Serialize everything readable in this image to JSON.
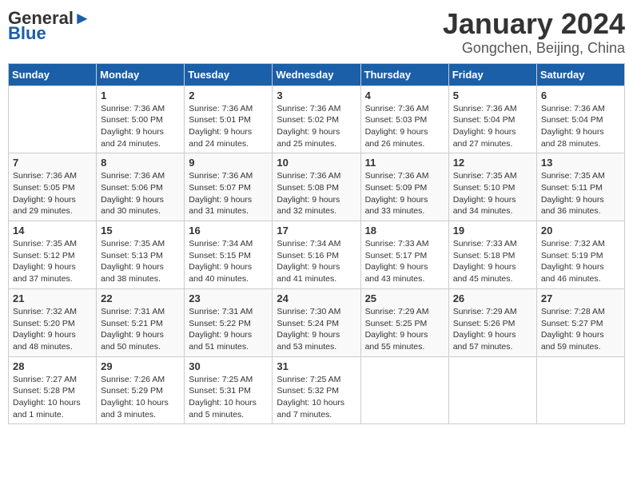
{
  "logo": {
    "name_part1": "General",
    "name_part2": "Blue"
  },
  "title": "January 2024",
  "subtitle": "Gongchen, Beijing, China",
  "weekdays": [
    "Sunday",
    "Monday",
    "Tuesday",
    "Wednesday",
    "Thursday",
    "Friday",
    "Saturday"
  ],
  "weeks": [
    [
      {
        "day": "",
        "sunrise": "",
        "sunset": "",
        "daylight": ""
      },
      {
        "day": "1",
        "sunrise": "Sunrise: 7:36 AM",
        "sunset": "Sunset: 5:00 PM",
        "daylight": "Daylight: 9 hours and 24 minutes."
      },
      {
        "day": "2",
        "sunrise": "Sunrise: 7:36 AM",
        "sunset": "Sunset: 5:01 PM",
        "daylight": "Daylight: 9 hours and 24 minutes."
      },
      {
        "day": "3",
        "sunrise": "Sunrise: 7:36 AM",
        "sunset": "Sunset: 5:02 PM",
        "daylight": "Daylight: 9 hours and 25 minutes."
      },
      {
        "day": "4",
        "sunrise": "Sunrise: 7:36 AM",
        "sunset": "Sunset: 5:03 PM",
        "daylight": "Daylight: 9 hours and 26 minutes."
      },
      {
        "day": "5",
        "sunrise": "Sunrise: 7:36 AM",
        "sunset": "Sunset: 5:04 PM",
        "daylight": "Daylight: 9 hours and 27 minutes."
      },
      {
        "day": "6",
        "sunrise": "Sunrise: 7:36 AM",
        "sunset": "Sunset: 5:04 PM",
        "daylight": "Daylight: 9 hours and 28 minutes."
      }
    ],
    [
      {
        "day": "7",
        "sunrise": "Sunrise: 7:36 AM",
        "sunset": "Sunset: 5:05 PM",
        "daylight": "Daylight: 9 hours and 29 minutes."
      },
      {
        "day": "8",
        "sunrise": "Sunrise: 7:36 AM",
        "sunset": "Sunset: 5:06 PM",
        "daylight": "Daylight: 9 hours and 30 minutes."
      },
      {
        "day": "9",
        "sunrise": "Sunrise: 7:36 AM",
        "sunset": "Sunset: 5:07 PM",
        "daylight": "Daylight: 9 hours and 31 minutes."
      },
      {
        "day": "10",
        "sunrise": "Sunrise: 7:36 AM",
        "sunset": "Sunset: 5:08 PM",
        "daylight": "Daylight: 9 hours and 32 minutes."
      },
      {
        "day": "11",
        "sunrise": "Sunrise: 7:36 AM",
        "sunset": "Sunset: 5:09 PM",
        "daylight": "Daylight: 9 hours and 33 minutes."
      },
      {
        "day": "12",
        "sunrise": "Sunrise: 7:35 AM",
        "sunset": "Sunset: 5:10 PM",
        "daylight": "Daylight: 9 hours and 34 minutes."
      },
      {
        "day": "13",
        "sunrise": "Sunrise: 7:35 AM",
        "sunset": "Sunset: 5:11 PM",
        "daylight": "Daylight: 9 hours and 36 minutes."
      }
    ],
    [
      {
        "day": "14",
        "sunrise": "Sunrise: 7:35 AM",
        "sunset": "Sunset: 5:12 PM",
        "daylight": "Daylight: 9 hours and 37 minutes."
      },
      {
        "day": "15",
        "sunrise": "Sunrise: 7:35 AM",
        "sunset": "Sunset: 5:13 PM",
        "daylight": "Daylight: 9 hours and 38 minutes."
      },
      {
        "day": "16",
        "sunrise": "Sunrise: 7:34 AM",
        "sunset": "Sunset: 5:15 PM",
        "daylight": "Daylight: 9 hours and 40 minutes."
      },
      {
        "day": "17",
        "sunrise": "Sunrise: 7:34 AM",
        "sunset": "Sunset: 5:16 PM",
        "daylight": "Daylight: 9 hours and 41 minutes."
      },
      {
        "day": "18",
        "sunrise": "Sunrise: 7:33 AM",
        "sunset": "Sunset: 5:17 PM",
        "daylight": "Daylight: 9 hours and 43 minutes."
      },
      {
        "day": "19",
        "sunrise": "Sunrise: 7:33 AM",
        "sunset": "Sunset: 5:18 PM",
        "daylight": "Daylight: 9 hours and 45 minutes."
      },
      {
        "day": "20",
        "sunrise": "Sunrise: 7:32 AM",
        "sunset": "Sunset: 5:19 PM",
        "daylight": "Daylight: 9 hours and 46 minutes."
      }
    ],
    [
      {
        "day": "21",
        "sunrise": "Sunrise: 7:32 AM",
        "sunset": "Sunset: 5:20 PM",
        "daylight": "Daylight: 9 hours and 48 minutes."
      },
      {
        "day": "22",
        "sunrise": "Sunrise: 7:31 AM",
        "sunset": "Sunset: 5:21 PM",
        "daylight": "Daylight: 9 hours and 50 minutes."
      },
      {
        "day": "23",
        "sunrise": "Sunrise: 7:31 AM",
        "sunset": "Sunset: 5:22 PM",
        "daylight": "Daylight: 9 hours and 51 minutes."
      },
      {
        "day": "24",
        "sunrise": "Sunrise: 7:30 AM",
        "sunset": "Sunset: 5:24 PM",
        "daylight": "Daylight: 9 hours and 53 minutes."
      },
      {
        "day": "25",
        "sunrise": "Sunrise: 7:29 AM",
        "sunset": "Sunset: 5:25 PM",
        "daylight": "Daylight: 9 hours and 55 minutes."
      },
      {
        "day": "26",
        "sunrise": "Sunrise: 7:29 AM",
        "sunset": "Sunset: 5:26 PM",
        "daylight": "Daylight: 9 hours and 57 minutes."
      },
      {
        "day": "27",
        "sunrise": "Sunrise: 7:28 AM",
        "sunset": "Sunset: 5:27 PM",
        "daylight": "Daylight: 9 hours and 59 minutes."
      }
    ],
    [
      {
        "day": "28",
        "sunrise": "Sunrise: 7:27 AM",
        "sunset": "Sunset: 5:28 PM",
        "daylight": "Daylight: 10 hours and 1 minute."
      },
      {
        "day": "29",
        "sunrise": "Sunrise: 7:26 AM",
        "sunset": "Sunset: 5:29 PM",
        "daylight": "Daylight: 10 hours and 3 minutes."
      },
      {
        "day": "30",
        "sunrise": "Sunrise: 7:25 AM",
        "sunset": "Sunset: 5:31 PM",
        "daylight": "Daylight: 10 hours and 5 minutes."
      },
      {
        "day": "31",
        "sunrise": "Sunrise: 7:25 AM",
        "sunset": "Sunset: 5:32 PM",
        "daylight": "Daylight: 10 hours and 7 minutes."
      },
      {
        "day": "",
        "sunrise": "",
        "sunset": "",
        "daylight": ""
      },
      {
        "day": "",
        "sunrise": "",
        "sunset": "",
        "daylight": ""
      },
      {
        "day": "",
        "sunrise": "",
        "sunset": "",
        "daylight": ""
      }
    ]
  ]
}
